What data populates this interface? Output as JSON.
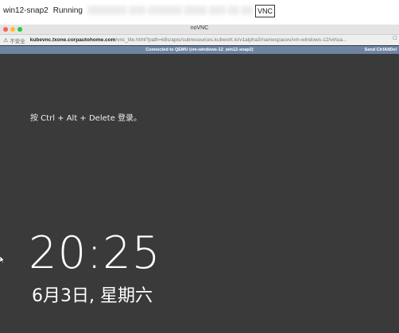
{
  "top_bar": {
    "vm_name": "win12-snap2",
    "status": "Running",
    "blurred_text": "▒▒▒▒▒▒▒ ▒▒▒ ▒▒▒▒▒▒ ▒▒▒▒ ▒▒▒ ▒▒ ▒▒",
    "vnc_label": "VNC"
  },
  "browser": {
    "window_title": "noVNC",
    "insecure_label": "不安全",
    "url_host": "kubevnc.txone.corpautohome.com",
    "url_path": "/vnc_lite.html?path=k8s/apis/subresources.kubevirt.io/v1alpha3/namespaces/vm-windows-12/virtua...",
    "addr_end": "□"
  },
  "novnc": {
    "connection_status": "Connected to QEMU (vm-windows-12_win12-snap2)",
    "send_cad_label": "Send CtrlAltDel"
  },
  "lock_screen": {
    "login_hint": "按 Ctrl + Alt + Delete 登录。",
    "time": "20:25",
    "date": "6月3日, 星期六"
  },
  "colors": {
    "novnc_bar": "#6e84a3",
    "screen_bg": "#3a3a3a"
  }
}
